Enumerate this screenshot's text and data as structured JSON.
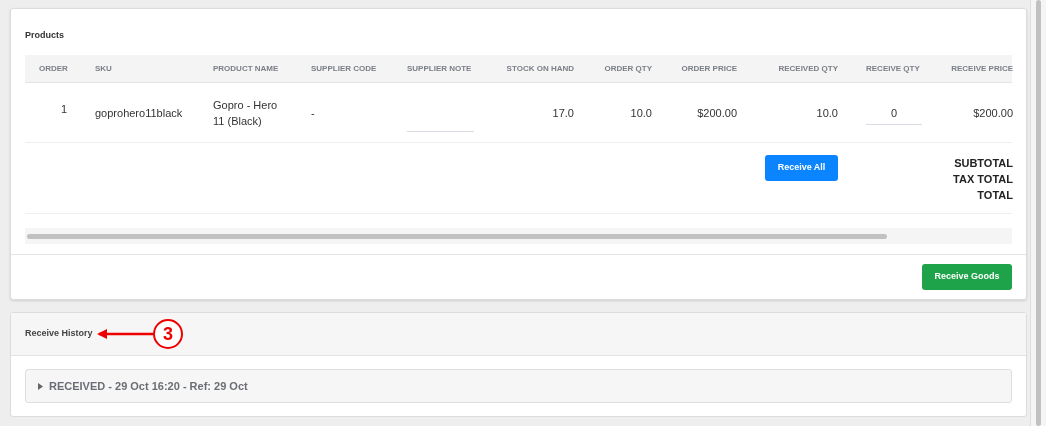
{
  "products": {
    "title": "Products",
    "columns": [
      "ORDER",
      "SKU",
      "PRODUCT NAME",
      "SUPPLIER CODE",
      "SUPPLIER NOTE",
      "STOCK ON HAND",
      "ORDER QTY",
      "ORDER PRICE",
      "RECEIVED QTY",
      "RECEIVE QTY",
      "RECEIVE PRICE"
    ],
    "rows": [
      [
        {
          "kind": "text",
          "text": "1"
        },
        {
          "kind": "text",
          "text": "goprohero11black"
        },
        {
          "kind": "text",
          "text": "Gopro - Hero 11 (Black)"
        },
        {
          "kind": "text",
          "text": "-"
        },
        {
          "kind": "input"
        },
        {
          "kind": "text",
          "text": "17.0"
        },
        {
          "kind": "text",
          "text": "10.0"
        },
        {
          "kind": "text",
          "text": "$200.00"
        },
        {
          "kind": "text",
          "text": "10.0"
        },
        {
          "kind": "input",
          "value": "0"
        },
        {
          "kind": "text",
          "text": "$200.00"
        }
      ]
    ],
    "receive_all_button": "Receive All",
    "totals": [
      "SUBTOTAL",
      "TAX TOTAL",
      "TOTAL"
    ],
    "receive_goods_button": "Receive Goods"
  },
  "receive_history": {
    "title": "Receive History",
    "entries": [
      {
        "text": "RECEIVED - 29 Oct 16:20 - Ref: 29 Oct",
        "expanded": false
      }
    ]
  },
  "annotation": {
    "text": "3"
  }
}
